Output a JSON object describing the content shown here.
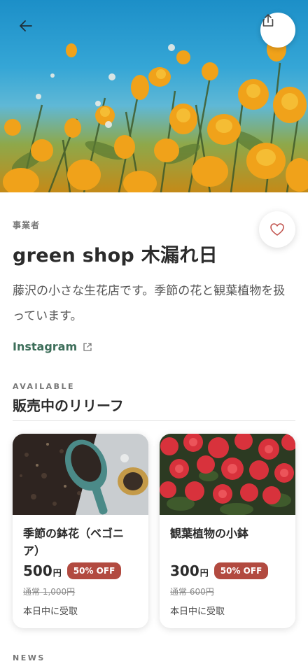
{
  "hero": {
    "back_icon": "arrow-left-icon",
    "share_icon": "share-icon"
  },
  "profile": {
    "kicker": "事業者",
    "name": "green shop 木漏れ日",
    "description": "藤沢の小さな生花店です。季節の花と観葉植物を扱っています。",
    "link_label": "Instagram",
    "link_icon": "external-link-icon",
    "favorite_icon": "heart-icon"
  },
  "reliefs": {
    "kicker": "AVAILABLE",
    "title": "販売中のリリーフ",
    "items": [
      {
        "title": "季節の鉢花（ベゴニア）",
        "price": "500",
        "currency": "円",
        "discount": "50% OFF",
        "original": "通常 1,000円",
        "pickup": "本日中に受取"
      },
      {
        "title": "観葉植物の小鉢",
        "price": "300",
        "currency": "円",
        "discount": "50% OFF",
        "original": "通常 600円",
        "pickup": "本日中に受取"
      }
    ]
  },
  "news": {
    "kicker": "NEWS"
  },
  "colors": {
    "accent_green": "#3d6e5a",
    "badge_red": "#b24a40",
    "heart_red": "#c0504a"
  }
}
